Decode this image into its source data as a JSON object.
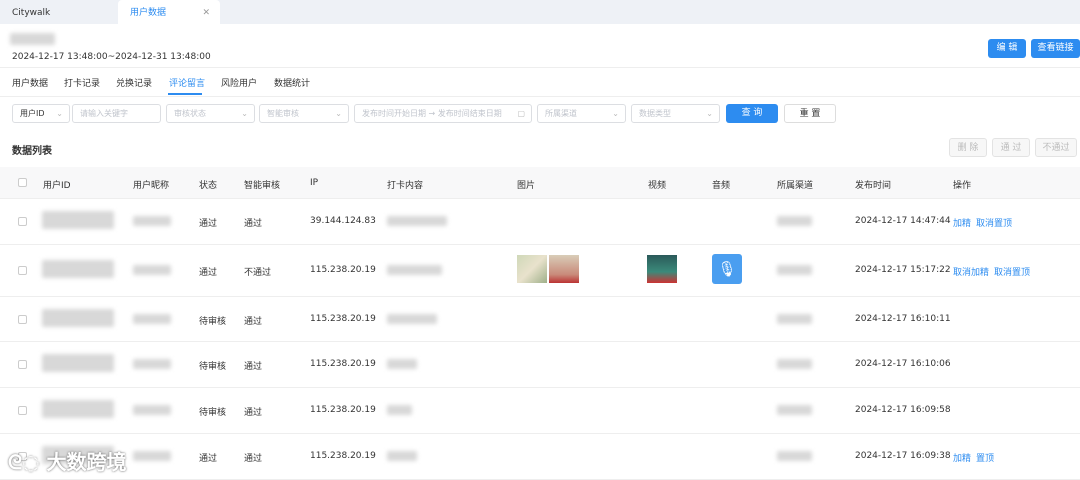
{
  "tabs": [
    {
      "label": "Citywalk"
    },
    {
      "label": "用户数据"
    }
  ],
  "header": {
    "date_range": "2024-12-17 13:48:00~2024-12-31 13:48:00",
    "edit": "编 辑",
    "view_link": "查看链接"
  },
  "nav": [
    "用户数据",
    "打卡记录",
    "兑换记录",
    "评论留言",
    "风险用户",
    "数据统计"
  ],
  "filters": {
    "type": "用户ID",
    "keyword": "请输入关键字",
    "audit": "审核状态",
    "smart": "智能审核",
    "start": "发布时间开始日期",
    "arrow": "→",
    "end": "发布时间结束日期",
    "channel": "所属渠道",
    "datatype": "数据类型",
    "query": "查 询",
    "reset": "重 置"
  },
  "list": {
    "title": "数据列表",
    "delete": "删 除",
    "pass": "通 过",
    "reject": "不通过"
  },
  "columns": [
    "用户ID",
    "用户昵称",
    "状态",
    "智能审核",
    "IP",
    "打卡内容",
    "图片",
    "视频",
    "音频",
    "所属渠道",
    "发布时间",
    "操作"
  ],
  "rows": [
    {
      "status": "通过",
      "smart": "通过",
      "ip": "39.144.124.83",
      "time": "2024-12-17 14:47:44",
      "a1": "加精",
      "a2": "取消置顶"
    },
    {
      "status": "通过",
      "smart": "不通过",
      "ip": "115.238.20.19",
      "time": "2024-12-17 15:17:22",
      "a1": "取消加精",
      "a2": "取消置顶"
    },
    {
      "status": "待审核",
      "smart": "通过",
      "ip": "115.238.20.19",
      "time": "2024-12-17 16:10:11",
      "a1": "",
      "a2": ""
    },
    {
      "status": "待审核",
      "smart": "通过",
      "ip": "115.238.20.19",
      "time": "2024-12-17 16:10:06",
      "a1": "",
      "a2": ""
    },
    {
      "status": "待审核",
      "smart": "通过",
      "ip": "115.238.20.19",
      "time": "2024-12-17 16:09:58",
      "a1": "",
      "a2": ""
    },
    {
      "status": "通过",
      "smart": "通过",
      "ip": "115.238.20.19",
      "time": "2024-12-17 16:09:38",
      "a1": "加精",
      "a2": "置顶"
    }
  ],
  "watermark": "大数跨境"
}
